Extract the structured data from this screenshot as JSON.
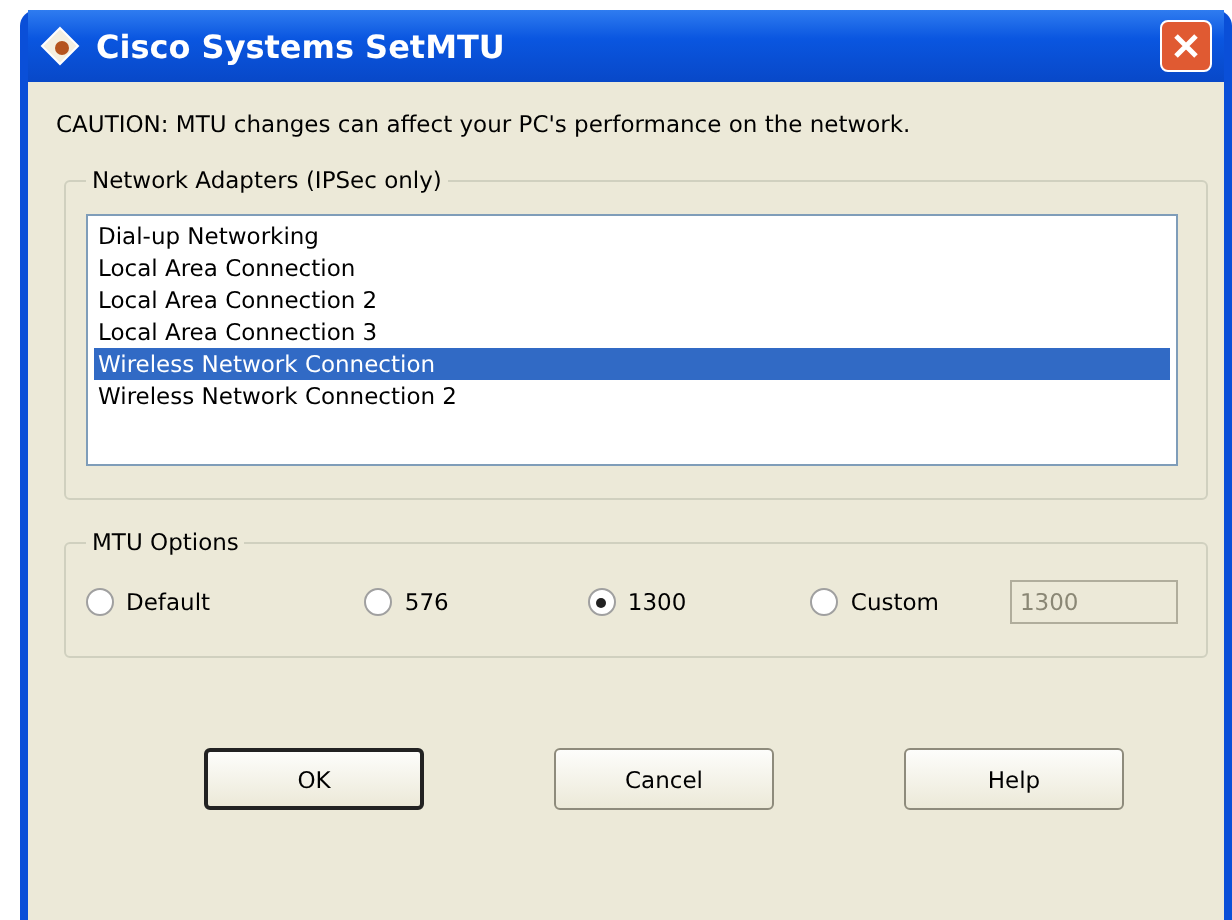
{
  "window": {
    "title": "Cisco Systems SetMTU"
  },
  "caution": "CAUTION: MTU changes can affect your PC's performance on the network.",
  "adapters": {
    "label": "Network Adapters (IPSec only)",
    "items": [
      {
        "name": "Dial-up Networking",
        "selected": false
      },
      {
        "name": "Local Area Connection",
        "selected": false
      },
      {
        "name": "Local Area Connection 2",
        "selected": false
      },
      {
        "name": "Local Area Connection 3",
        "selected": false
      },
      {
        "name": "Wireless Network Connection",
        "selected": true
      },
      {
        "name": "Wireless Network Connection 2",
        "selected": false
      }
    ]
  },
  "mtu_options": {
    "label": "MTU Options",
    "options": [
      {
        "label": "Default",
        "selected": false
      },
      {
        "label": "576",
        "selected": false
      },
      {
        "label": "1300",
        "selected": true
      },
      {
        "label": "Custom",
        "selected": false
      }
    ],
    "custom_field": {
      "value": "1300",
      "disabled": true
    }
  },
  "buttons": [
    {
      "label": "OK",
      "default": true
    },
    {
      "label": "Cancel",
      "default": false
    },
    {
      "label": "Help",
      "default": false
    }
  ]
}
